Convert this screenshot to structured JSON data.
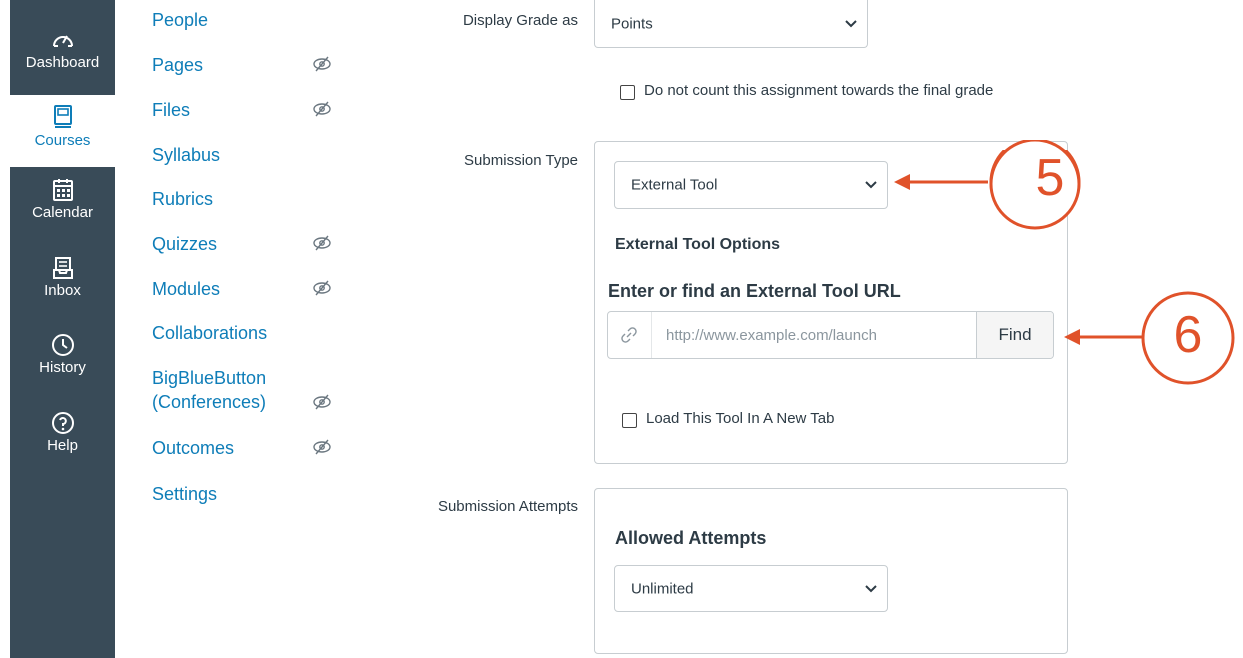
{
  "global_nav": {
    "items": [
      {
        "label": "Dashboard",
        "icon": "dashboard-gauge-icon",
        "active": false
      },
      {
        "label": "Courses",
        "icon": "courses-book-icon",
        "active": true
      },
      {
        "label": "Calendar",
        "icon": "calendar-icon",
        "active": false
      },
      {
        "label": "Inbox",
        "icon": "inbox-icon",
        "active": false
      },
      {
        "label": "History",
        "icon": "history-clock-icon",
        "active": false
      },
      {
        "label": "Help",
        "icon": "help-question-icon",
        "active": false
      }
    ]
  },
  "course_nav": {
    "items": [
      {
        "label": "People",
        "hidden_icon": false
      },
      {
        "label": "Pages",
        "hidden_icon": true
      },
      {
        "label": "Files",
        "hidden_icon": true
      },
      {
        "label": "Syllabus",
        "hidden_icon": false
      },
      {
        "label": "Rubrics",
        "hidden_icon": false
      },
      {
        "label": "Quizzes",
        "hidden_icon": true
      },
      {
        "label": "Modules",
        "hidden_icon": true
      },
      {
        "label": "Collaborations",
        "hidden_icon": false
      },
      {
        "label": "BigBlueButton\n(Conferences)",
        "line1": "BigBlueButton",
        "line2": "(Conferences)",
        "hidden_icon": true
      },
      {
        "label": "Outcomes",
        "hidden_icon": true
      },
      {
        "label": "Settings",
        "hidden_icon": false
      }
    ]
  },
  "form": {
    "display_grade": {
      "label": "Display Grade as",
      "value": "Points"
    },
    "final_grade_checkbox": {
      "label": "Do not count this assignment towards the final grade",
      "checked": false
    },
    "submission_type": {
      "label": "Submission Type",
      "value": "External Tool",
      "options_heading": "External Tool Options",
      "url_heading": "Enter or find an External Tool URL",
      "url_placeholder": "http://www.example.com/launch",
      "find_label": "Find",
      "new_tab_checkbox": {
        "label": "Load This Tool In A New Tab",
        "checked": false
      }
    },
    "submission_attempts": {
      "label": "Submission Attempts",
      "allowed_heading": "Allowed Attempts",
      "value": "Unlimited"
    }
  },
  "annotations": [
    {
      "number": "5",
      "color": "#e0522a"
    },
    {
      "number": "6",
      "color": "#e0522a"
    }
  ],
  "colors": {
    "nav_bg": "#394b58",
    "link": "#0e7db8",
    "annotation": "#e0522a"
  }
}
